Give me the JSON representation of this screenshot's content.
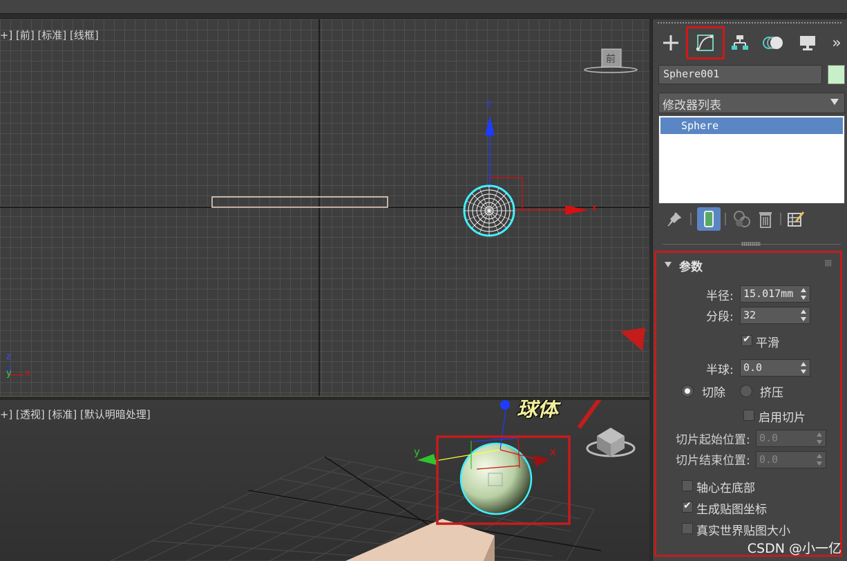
{
  "viewport_front": {
    "label": "[+] [前] [标准] [线框]",
    "viewcube_label": "前"
  },
  "viewport_persp": {
    "label": "[+] [透视] [标准] [默认明暗处理]"
  },
  "axes": {
    "x": "x",
    "y": "y",
    "z": "z"
  },
  "annotation": {
    "text": "球体"
  },
  "command_panel": {
    "tabs": [
      "create-icon",
      "modify-icon",
      "hierarchy-icon",
      "motion-icon",
      "display-icon",
      "more-icon"
    ],
    "more_label": "»",
    "object_name": "Sphere001",
    "object_color": "#c8f0c8",
    "modifier_list_label": "修改器列表",
    "stack_items": [
      "Sphere"
    ],
    "params": {
      "title": "参数",
      "radius_label": "半径:",
      "radius_value": "15.017mm",
      "segments_label": "分段:",
      "segments_value": "32",
      "smooth_label": "平滑",
      "smooth_checked": true,
      "hemisphere_label": "半球:",
      "hemisphere_value": "0.0",
      "chop_label": "切除",
      "squash_label": "挤压",
      "slice_on_label": "启用切片",
      "slice_from_label": "切片起始位置:",
      "slice_from_value": "0.0",
      "slice_to_label": "切片结束位置:",
      "slice_to_value": "0.0",
      "base_to_pivot_label": "轴心在底部",
      "gen_mapping_label": "生成贴图坐标",
      "real_world_label": "真实世界贴图大小"
    }
  },
  "watermark": "CSDN @小一亿",
  "colors": {
    "highlight_red": "#c41c1c",
    "selection_blue": "#5b86c4",
    "sphere_cyan": "#40f0ff"
  }
}
